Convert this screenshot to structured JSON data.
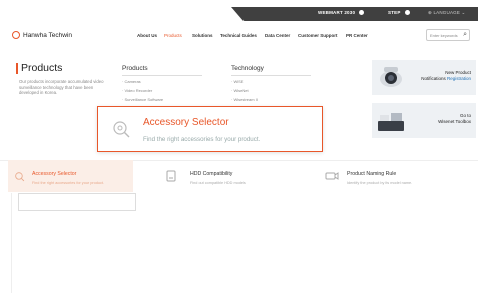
{
  "topbar": {
    "items": [
      {
        "label": "WEBMART",
        "icon": "dot-icon"
      },
      {
        "label": "STEP",
        "icon": "dot-icon"
      },
      {
        "label": "LANGUAGE",
        "icon": "globe-icon"
      }
    ]
  },
  "header": {
    "logo": "Hanwha Techwin",
    "nav": [
      "About Us",
      "Products",
      "Solutions",
      "Technical Guides",
      "Data Center",
      "Customer Support",
      "PR Center"
    ],
    "search_placeholder": "Enter keywords"
  },
  "mega": {
    "title": "Products",
    "description": "Our products incorporate accumulated video surveillance technology that have been developed in Korea.",
    "columns": [
      {
        "title": "Products",
        "items": [
          "Cameras",
          "Video Recorder",
          "Surveillance Software"
        ]
      },
      {
        "title": "Technology",
        "items": [
          "WiSE",
          "WiseNet",
          "Wisestream II"
        ]
      }
    ],
    "promos": [
      {
        "line1": "New Product",
        "line2": "Notifications",
        "line2b": "Registration"
      },
      {
        "line1": "Go to",
        "line2": "Wisenet Toolbox"
      }
    ]
  },
  "accessory_popup": {
    "title": "Accessory Selector",
    "subtitle": "Find the right accessories for your product."
  },
  "tabs": [
    {
      "title": "Accessory Selector",
      "subtitle": "Find the right accessories for your product."
    },
    {
      "title": "HDD Compatibility",
      "subtitle": "Find out compatible HDD models"
    },
    {
      "title": "Product Naming Rule",
      "subtitle": "Identify the product by its model name."
    }
  ],
  "colors": {
    "accent": "#e8572a",
    "topbar": "#404040"
  }
}
